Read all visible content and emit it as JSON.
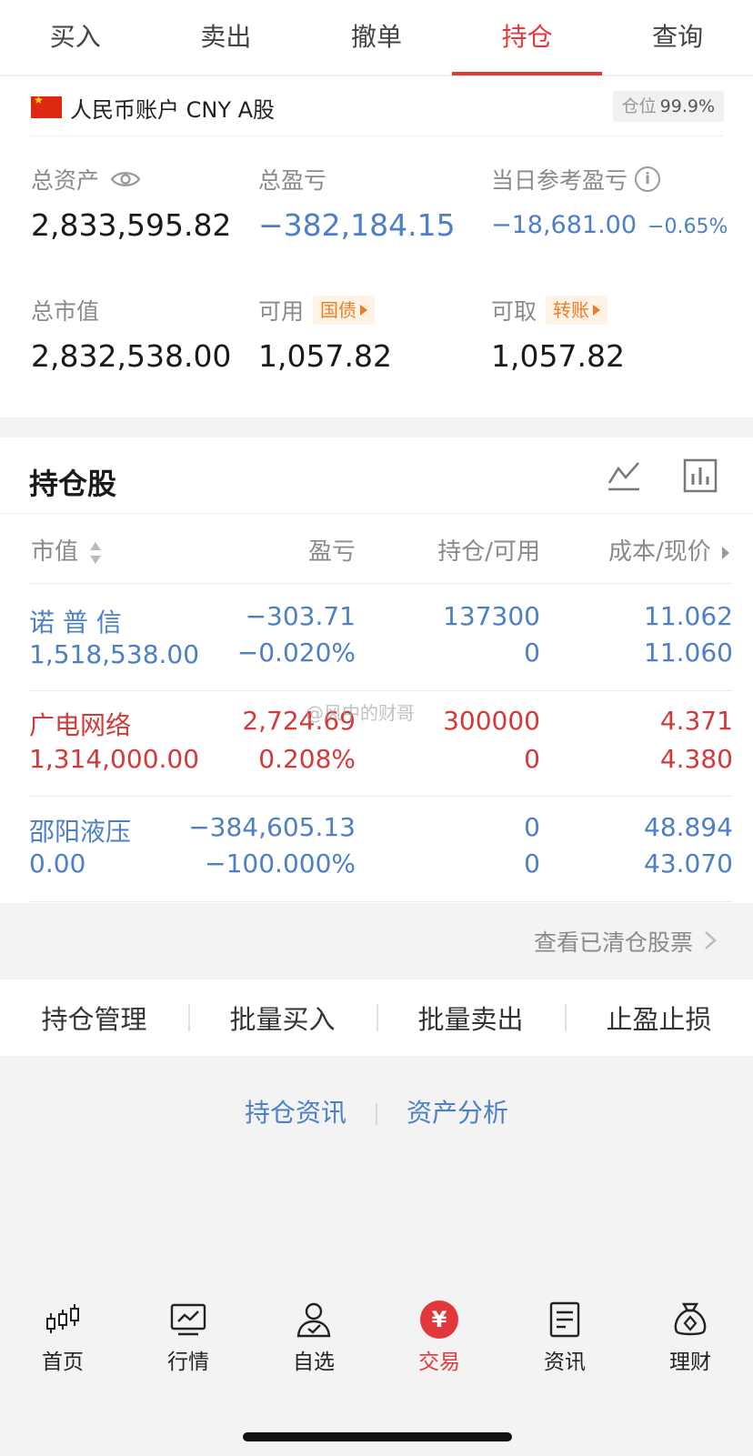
{
  "tabs": [
    "买入",
    "卖出",
    "撤单",
    "持仓",
    "查询"
  ],
  "account": {
    "label": "人民币账户 CNY A股",
    "position_label": "仓位",
    "position_value": "99.9%"
  },
  "summary": {
    "total_assets_label": "总资产",
    "total_assets": "2,833,595.82",
    "total_pnl_label": "总盈亏",
    "total_pnl": "−382,184.15",
    "daily_pnl_label": "当日参考盈亏",
    "daily_pnl": "−18,681.00",
    "daily_pnl_pct": "−0.65%",
    "market_value_label": "总市值",
    "market_value": "2,832,538.00",
    "available_label": "可用",
    "available_tag": "国债",
    "available": "1,057.82",
    "withdrawable_label": "可取",
    "withdrawable_tag": "转账",
    "withdrawable": "1,057.82"
  },
  "holdings": {
    "title": "持仓股",
    "headers": {
      "market_value": "市值",
      "pnl": "盈亏",
      "position": "持仓/可用",
      "cost": "成本/现价"
    },
    "rows": [
      {
        "name": "诺 普 信",
        "market_value": "1,518,538.00",
        "pnl": "−303.71",
        "pnl_pct": "−0.020%",
        "position": "137300",
        "available": "0",
        "cost": "11.062",
        "price": "11.060",
        "color": "#4d7fc7"
      },
      {
        "name": "广电网络",
        "market_value": "1,314,000.00",
        "pnl": "2,724.69",
        "pnl_pct": "0.208%",
        "position": "300000",
        "available": "0",
        "cost": "4.371",
        "price": "4.380",
        "color": "#d23a3a"
      },
      {
        "name": "邵阳液压",
        "market_value": "0.00",
        "pnl": "−384,605.13",
        "pnl_pct": "−100.000%",
        "position": "0",
        "available": "0",
        "cost": "48.894",
        "price": "43.070",
        "color": "#4d7fc7"
      }
    ],
    "watermark": "@风中的财哥"
  },
  "cleared_link": "查看已清仓股票",
  "actions": [
    "持仓管理",
    "批量买入",
    "批量卖出",
    "止盈止损"
  ],
  "links": [
    "持仓资讯",
    "资产分析"
  ],
  "bottom_nav": [
    "首页",
    "行情",
    "自选",
    "交易",
    "资讯",
    "理财"
  ],
  "trade_icon_glyph": "¥",
  "colors": {
    "accent": "#e2383b",
    "up": "#d23a3a",
    "down": "#4d7fc7",
    "tag": "#f07c22"
  }
}
